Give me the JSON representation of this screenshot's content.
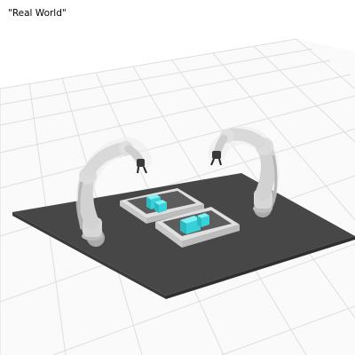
{
  "window": {
    "title": "\"Real World\""
  },
  "colors": {
    "background": "#ffffff",
    "grid_line": "#dcdcdc",
    "grid_floor": "#f4f4f4",
    "table_top": "#454545",
    "table_edge": "#2e2e2e",
    "robot_body": "#d8d8d8",
    "robot_shadow": "#a9a9a9",
    "tray": "#d9d9d9",
    "cube": "#35d0d8"
  },
  "scene": {
    "objects": [
      {
        "name": "left-robot-arm",
        "type": "robot"
      },
      {
        "name": "right-robot-arm",
        "type": "robot"
      },
      {
        "name": "left-tray",
        "type": "tray"
      },
      {
        "name": "right-tray",
        "type": "tray"
      },
      {
        "name": "cyan-cube",
        "type": "cube",
        "count": 4
      }
    ]
  }
}
